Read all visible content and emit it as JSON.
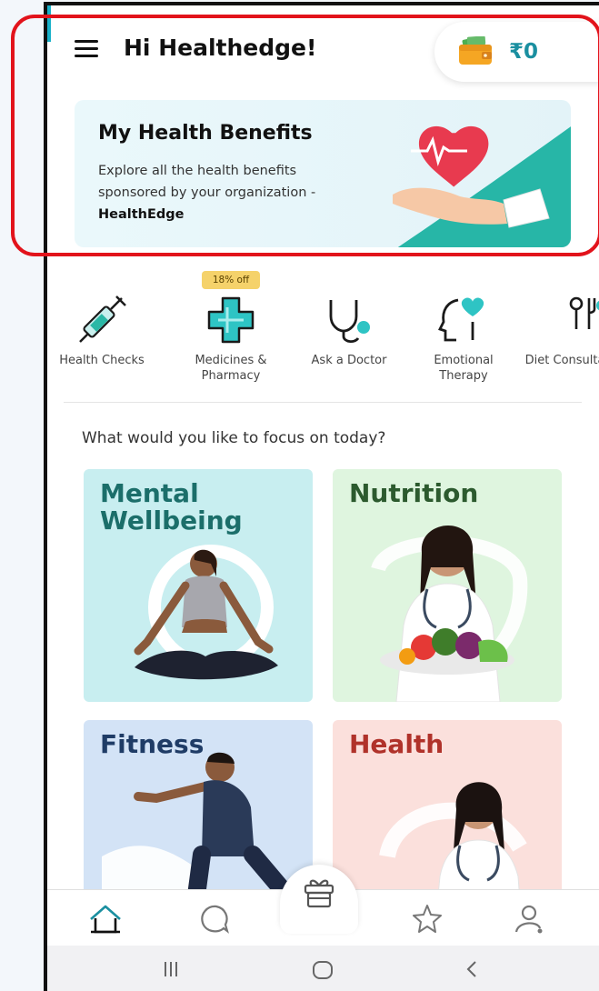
{
  "header": {
    "greeting": "Hi Healthedge!",
    "wallet_amount": "₹0"
  },
  "benefits_card": {
    "title": "My Health Benefits",
    "description": "Explore all the health benefits sponsored by your organization -",
    "organization": "HealthEdge"
  },
  "services": [
    {
      "label": "Health Checks",
      "icon": "syringe-icon"
    },
    {
      "label": "Medicines & Pharmacy",
      "icon": "medical-cross-icon",
      "badge": "18% off"
    },
    {
      "label": "Ask a Doctor",
      "icon": "stethoscope-icon"
    },
    {
      "label": "Emotional Therapy",
      "icon": "heart-head-icon"
    },
    {
      "label": "Diet Consultation",
      "icon": "diet-icon"
    }
  ],
  "focus": {
    "heading": "What would you like to focus on today?",
    "tiles": [
      {
        "title": "Mental Wellbeing",
        "bg": "#c8eef0",
        "title_color": "#1b6e6a"
      },
      {
        "title": "Nutrition",
        "bg": "#dff5df",
        "title_color": "#2c5a2e"
      },
      {
        "title": "Fitness",
        "bg": "#d3e3f6",
        "title_color": "#1f3c66"
      },
      {
        "title": "Health",
        "bg": "#fbe0dc",
        "title_color": "#b0322a"
      }
    ]
  },
  "bottom_nav": [
    {
      "icon": "home-icon",
      "active": true
    },
    {
      "icon": "chat-icon",
      "active": false
    },
    {
      "icon": "gift-icon",
      "active": false
    },
    {
      "icon": "star-icon",
      "active": false
    },
    {
      "icon": "profile-icon",
      "active": false
    }
  ],
  "system_nav": [
    "recent-apps-icon",
    "home-button-icon",
    "back-icon"
  ],
  "colors": {
    "accent": "#19b1c9",
    "highlight": "#e2131b",
    "wallet_text": "#1a8fa0"
  }
}
